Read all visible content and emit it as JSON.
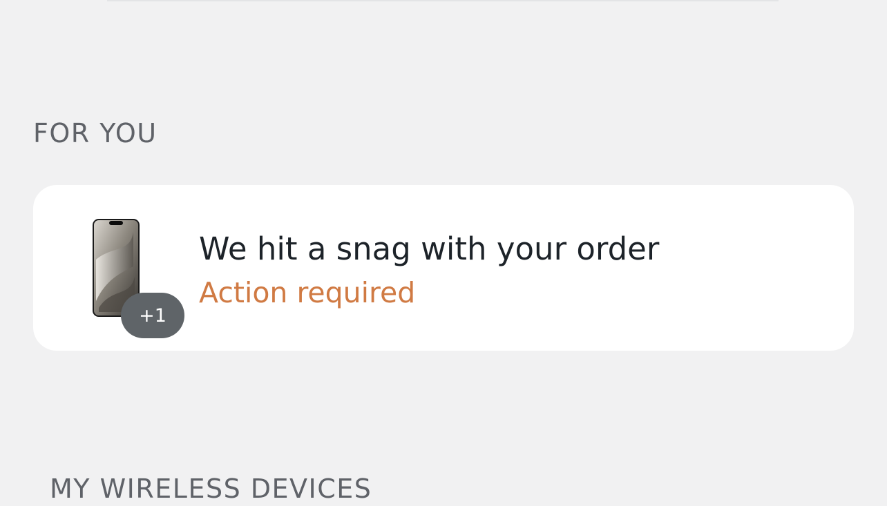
{
  "sections": {
    "for_you_title": "FOR YOU",
    "my_devices_title": "MY WIRELESS DEVICES"
  },
  "notification_card": {
    "title": "We hit a snag with your order",
    "status": "Action required",
    "extra_items_badge": "+1",
    "device_image": "phone-image",
    "status_color": "#d07a43"
  },
  "colors": {
    "background": "#f1f1f2",
    "card_background": "#ffffff",
    "heading_gray": "#5f6268",
    "badge_gray": "#5f6468",
    "title_dark": "#1d2329"
  }
}
